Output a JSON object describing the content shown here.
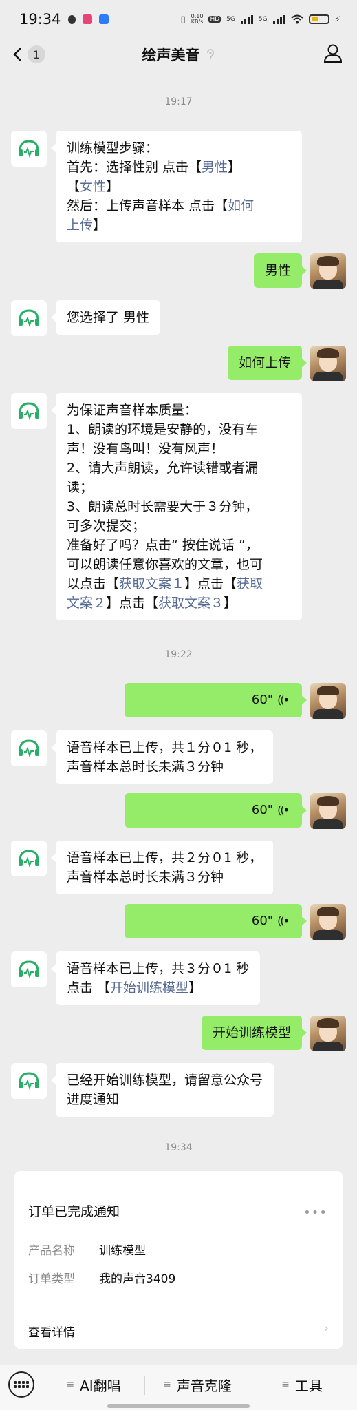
{
  "status_bar": {
    "time": "19:34",
    "net_speed": "0.10",
    "net_unit": "KB/s",
    "hd": "HD",
    "sig1": "5G",
    "sig2": "5G"
  },
  "header": {
    "unread_count": "1",
    "title": "绘声美音"
  },
  "timestamps": [
    "19:17",
    "19:22",
    "19:34"
  ],
  "messages": {
    "m1": {
      "l1": "训练模型步骤：",
      "l2a": "首先：选择性别 点击【",
      "l2b": "男性",
      "l2c": "】",
      "l3a": "【",
      "l3b": "女性",
      "l3c": "】",
      "l4a": "然后：上传声音样本 点击【",
      "l4b": "如何",
      "l5a": "上传",
      "l5b": "】"
    },
    "m2": "男性",
    "m3": "您选择了 男性",
    "m4": "如何上传",
    "m5": {
      "l1": "为保证声音样本质量：",
      "l2": "1、朗读的环境是安静的，没有车",
      "l3": "声！没有鸟叫！没有风声！",
      "l4": "2、请大声朗读，允许读错或者漏",
      "l5": "读；",
      "l6": "3、朗读总时长需要大于３分钟，",
      "l7": "可多次提交；",
      "l8": "准备好了吗？点击“ 按住说话 ”，",
      "l9": "可以朗读任意你喜欢的文章，也可",
      "l10a": "以点击【",
      "l10b": "获取文案１",
      "l10c": "】点击【",
      "l10d": "获取",
      "l11a": "文案２",
      "l11b": "】点击【",
      "l11c": "获取文案３",
      "l11d": "】"
    },
    "voice1": "60\"",
    "m6": {
      "l1": "语音样本已上传，共１分０1 秒，",
      "l2": "声音样本总时长未满３分钟"
    },
    "voice2": "60\"",
    "m7": {
      "l1": "语音样本已上传，共２分０1 秒，",
      "l2": "声音样本总时长未满３分钟"
    },
    "voice3": "60\"",
    "m8": {
      "l1": "语音样本已上传，共３分０1 秒",
      "l2a": " 点击 【",
      "l2b": "开始训练模型",
      "l2c": "】"
    },
    "m9": "开始训练模型",
    "m10": {
      "l1": "已经开始训练模型，请留意公众号",
      "l2": "进度通知"
    }
  },
  "card": {
    "title": "订单已完成通知",
    "more": "•••",
    "rows": [
      {
        "k": "产品名称",
        "v": "训练模型"
      },
      {
        "k": "订单类型",
        "v": "我的声音3409"
      }
    ],
    "detail": "查看详情"
  },
  "bottom_menu": {
    "items": [
      "AI翻唱",
      "声音克隆",
      "工具"
    ]
  },
  "colors": {
    "bubble_green": "#95ec69",
    "link_blue": "#576b95",
    "bot_icon_teal": "#2aae67"
  },
  "icons": {
    "bot_avatar": "headphones-icon",
    "voice": "voice-wave-icon",
    "keyboard": "keyboard-icon",
    "user": "user-icon"
  }
}
